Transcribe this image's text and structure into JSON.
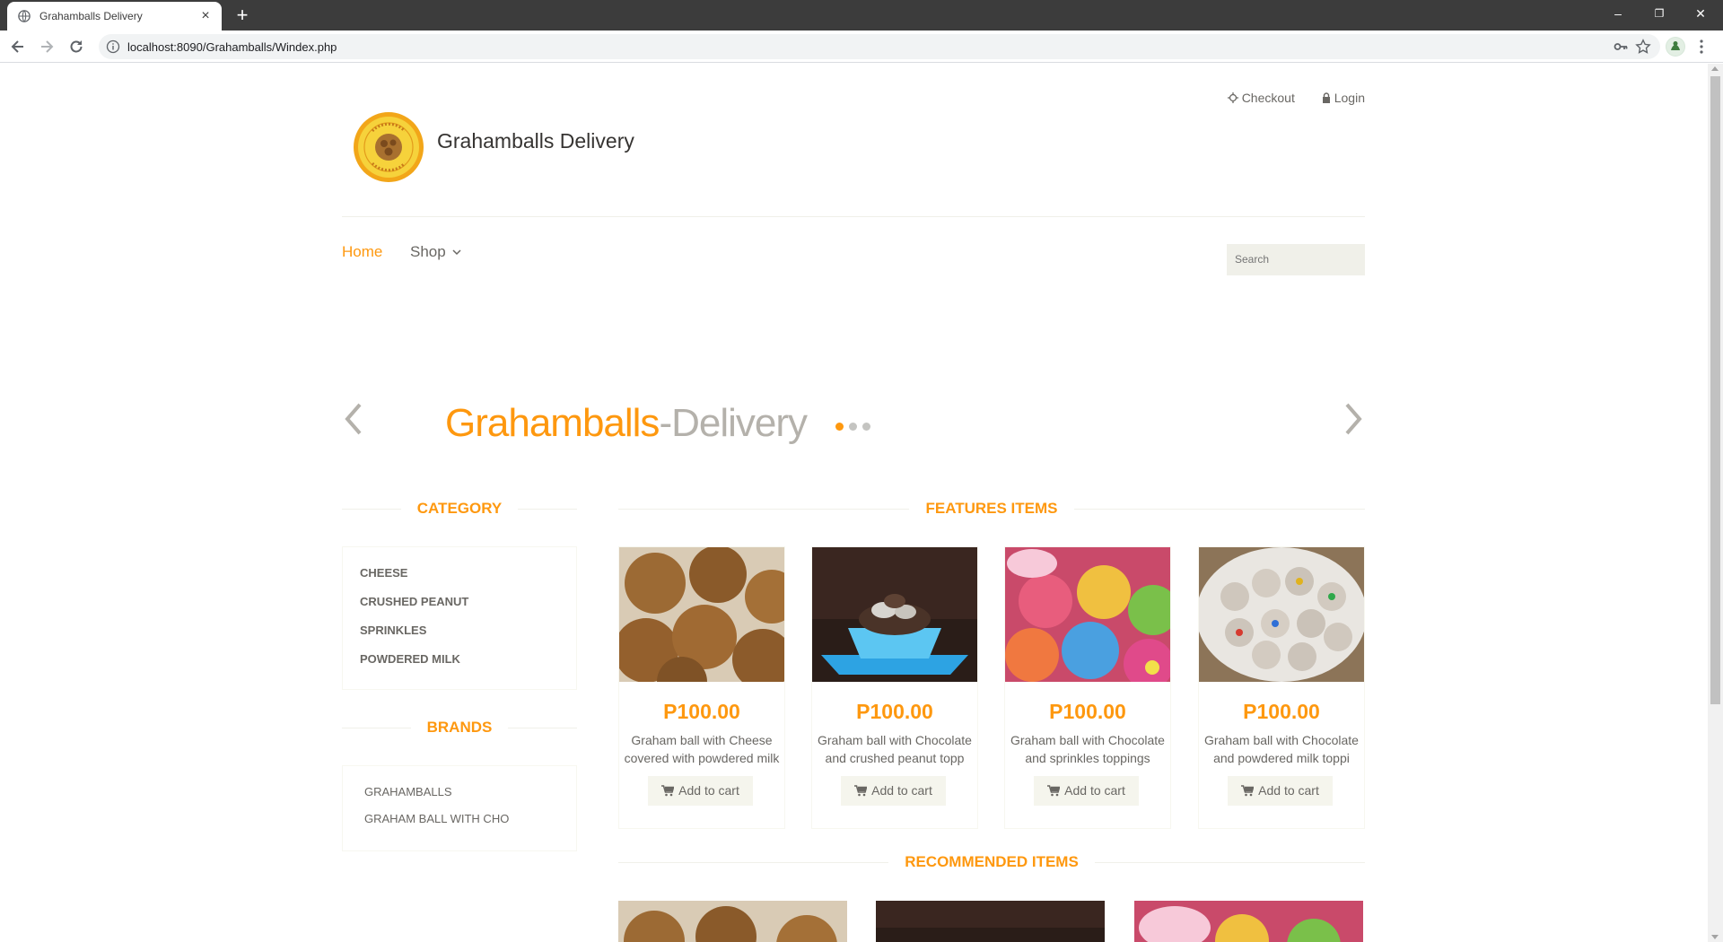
{
  "browser": {
    "tab_title": "Grahamballs Delivery",
    "tab_close": "×",
    "new_tab": "+",
    "url": "localhost:8090/Grahamballs/Windex.php",
    "minimize": "–",
    "restore": "❐",
    "close": "✕"
  },
  "header": {
    "checkout_label": "Checkout",
    "login_label": "Login",
    "site_title": "Grahamballs Delivery"
  },
  "nav": {
    "home_label": "Home",
    "shop_label": "Shop",
    "search_placeholder": "Search"
  },
  "slider": {
    "title_part1": "Grahamballs",
    "title_part2": "-Delivery",
    "slide_count": 3,
    "active_slide": 1
  },
  "sidebar": {
    "category_title": "CATEGORY",
    "categories": [
      "CHEESE",
      "CRUSHED PEANUT",
      "SPRINKLES",
      "POWDERED MILK"
    ],
    "brands_title": "BRANDS",
    "brands": [
      "GRAHAMBALLS",
      "GRAHAM BALL WITH CHO"
    ]
  },
  "features": {
    "title": "FEATURES ITEMS",
    "items": [
      {
        "price": "P100.00",
        "name": "Graham ball with Cheese covered with powdered milk",
        "button": "Add to cart"
      },
      {
        "price": "P100.00",
        "name": "Graham ball with Chocolate and crushed peanut topp",
        "button": "Add to cart"
      },
      {
        "price": "P100.00",
        "name": "Graham ball with Chocolate and sprinkles toppings",
        "button": "Add to cart"
      },
      {
        "price": "P100.00",
        "name": "Graham ball with Chocolate and powdered milk toppi",
        "button": "Add to cart"
      }
    ]
  },
  "recommended": {
    "title": "RECOMMENDED ITEMS"
  },
  "colors": {
    "accent": "#FE980F",
    "text": "#696763",
    "muted_panel": "#F0F0E9"
  }
}
